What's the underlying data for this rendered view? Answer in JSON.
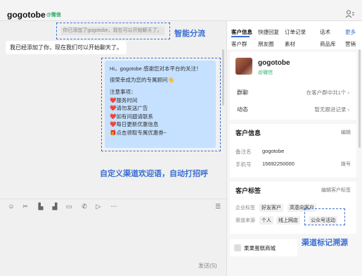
{
  "header": {
    "title": "gogotobe",
    "badge": "@微信"
  },
  "chat": {
    "system_message": "你已添加了gogotobe，现在可以开始聊天了。",
    "left_message": "我已经添加了你，现在我们可以开始聊天了。",
    "welcome": {
      "line1": "Hi，gogotobe 感谢您对本平台的关注！",
      "line2": "很荣幸成为您的专属顾问👋",
      "line3": "",
      "line4": "注意事项：",
      "item1": "服务时间",
      "item2": "请勿发送广告",
      "item3": "如有问题请联系",
      "item4": "每日更新优惠信息",
      "item5": "点击领取专属优惠券~"
    },
    "annotations": {
      "smart_divert": "智能分流",
      "custom_welcome": "自定义渠道欢迎语，自动打招呼",
      "channel_tag": "渠道标记溯源"
    },
    "send_label": "发送(S)"
  },
  "toolbar": {
    "icons": [
      "emoji-icon",
      "scissors-icon",
      "chart-icon",
      "chart2-icon",
      "folder-icon",
      "phone-icon",
      "video-icon",
      "more-icon"
    ]
  },
  "panel": {
    "tabs_row1": [
      "客户信息",
      "快捷回复",
      "订单记录",
      "话术",
      "更多"
    ],
    "tabs_row2": [
      "客户群",
      "朋友圈",
      "素材",
      "商品库",
      "营销"
    ],
    "customer": {
      "name": "gogotobe",
      "from": "@微信",
      "row1_label": "群聊",
      "row1_value": "在客户群中共1个",
      "row2_label": "动态",
      "row2_value": "暂无跟进记录"
    },
    "info": {
      "title": "客户信息",
      "action": "编辑",
      "name_label": "备注名",
      "name_value": "gogotobe",
      "phone_label": "手机号",
      "phone_value": "15692250000",
      "phone_action": "拨号"
    },
    "tags": {
      "title": "客户标签",
      "action": "编辑客户标签",
      "group1_label": "企业标签",
      "group1_tags": [
        "好友客户",
        "高意向客户"
      ],
      "group2_label": "渠道来源",
      "group2_tags": [
        "个人",
        "线上网店",
        "公众号活动"
      ]
    },
    "shop": "果果蛋糕商城"
  },
  "colors": {
    "accent": "#3b6fd1",
    "bubble_self": "#c5e1ff",
    "wechat_green": "#2aae67"
  }
}
